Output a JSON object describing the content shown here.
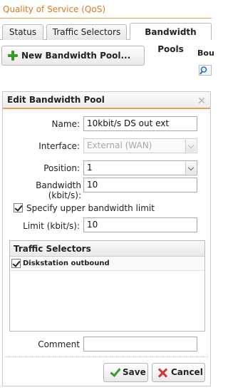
{
  "app": {
    "title": "Quality of Service (QoS)"
  },
  "tabs": [
    {
      "label": "Status"
    },
    {
      "label": "Traffic Selectors"
    },
    {
      "label": "Bandwidth Pools"
    }
  ],
  "toolbar": {
    "new_pool_label": "New Bandwidth Pool...",
    "side_label": "Bou"
  },
  "dialog": {
    "title": "Edit Bandwidth Pool",
    "fields": {
      "name": {
        "label": "Name:",
        "value": "10kbit/s DS out ext"
      },
      "interface": {
        "label": "Interface:",
        "value": "External (WAN)"
      },
      "position": {
        "label": "Position:",
        "value": "1"
      },
      "bandwidth": {
        "label": "Bandwidth (kbit/s):",
        "value": "10"
      },
      "upper_limit": {
        "label": "Specify upper bandwidth limit",
        "checked": true
      },
      "limit": {
        "label": "Limit (kbit/s):",
        "value": "10"
      },
      "comment": {
        "label": "Comment",
        "value": ""
      }
    },
    "traffic_selectors": {
      "title": "Traffic Selectors",
      "items": [
        {
          "label": "Diskstation outbound",
          "checked": true
        }
      ]
    },
    "buttons": {
      "save": "Save",
      "cancel": "Cancel"
    }
  },
  "colors": {
    "accent": "#e07a1a",
    "ok": "#3c9a2a",
    "danger": "#d23434"
  }
}
